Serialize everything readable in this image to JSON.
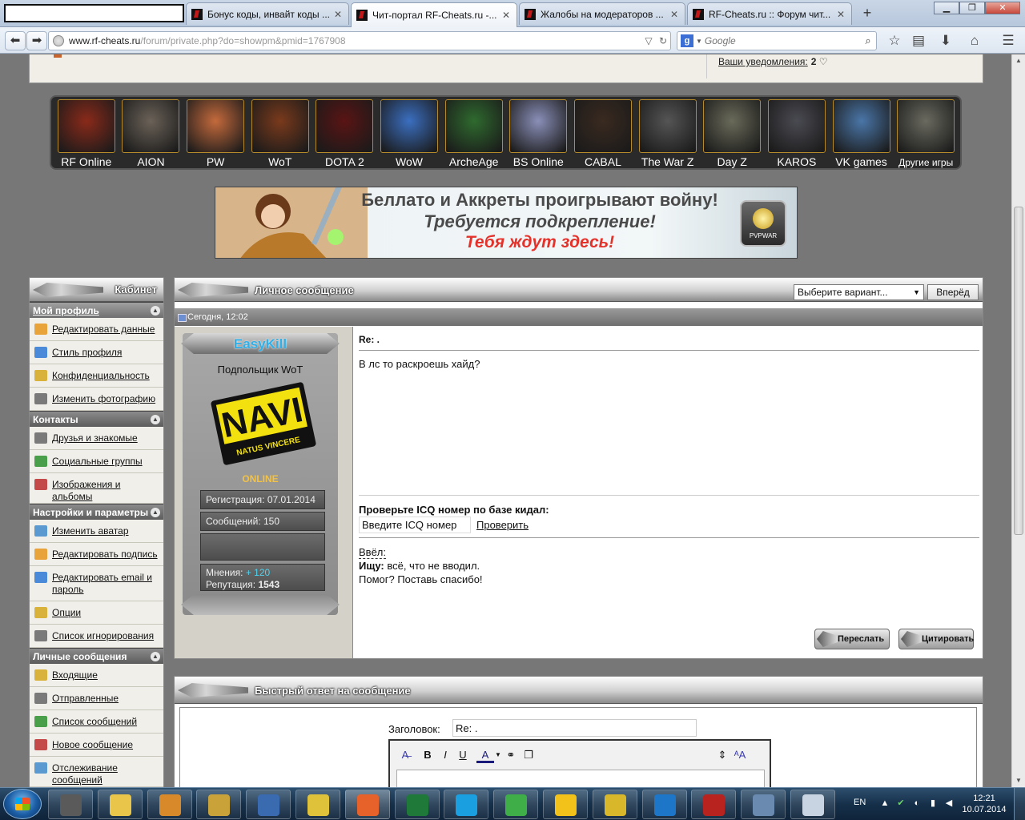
{
  "browser": {
    "tabs": [
      {
        "label": "Бонус коды, инвайт коды ..."
      },
      {
        "label": "Чит-портал RF-Cheats.ru -..."
      },
      {
        "label": "Жалобы на модераторов ..."
      },
      {
        "label": "RF-Cheats.ru :: Форум чит..."
      }
    ],
    "new_tab": "+",
    "url_domain": "www.rf-cheats.ru",
    "url_path": "/forum/private.php?do=showpm&pmid=1767908",
    "search_placeholder": "Google",
    "search_engine_letter": "g"
  },
  "page": {
    "notifications_label": "Ваши уведомления:",
    "notifications_count": "2",
    "games": [
      {
        "label": "RF Online",
        "color": "#8a2a1a"
      },
      {
        "label": "AION",
        "color": "#6b6258"
      },
      {
        "label": "PW",
        "color": "#c46a3c"
      },
      {
        "label": "WoT",
        "color": "#7a3a1c"
      },
      {
        "label": "DOTA 2",
        "color": "#5a1414"
      },
      {
        "label": "WoW",
        "color": "#3b6fc0"
      },
      {
        "label": "ArcheAge",
        "color": "#2f6a2f"
      },
      {
        "label": "BS Online",
        "color": "#8a8fb8"
      },
      {
        "label": "CABAL",
        "color": "#3a2a20"
      },
      {
        "label": "The War Z",
        "color": "#555555"
      },
      {
        "label": "Day Z",
        "color": "#6a6a5a"
      },
      {
        "label": "KAROS",
        "color": "#4a4a52"
      },
      {
        "label": "VK games",
        "color": "#4a76a8"
      },
      {
        "label": "Другие игры",
        "color": "#6a6a60"
      }
    ],
    "banner": {
      "line1": "Беллато и Аккреты проигрывают войну!",
      "line2": "Требуется подкрепление!",
      "line3": "Тебя ждут здесь!",
      "logo_text": "PVPWAR"
    },
    "sidebar": {
      "title": "Кабинет",
      "sections": [
        {
          "title": "Мой профиль",
          "items": [
            "Редактировать данные",
            "Стиль профиля",
            "Конфиденциальность",
            "Изменить фотографию"
          ]
        },
        {
          "title": "Контакты",
          "items": [
            "Друзья и знакомые",
            "Социальные группы",
            "Изображения и альбомы"
          ]
        },
        {
          "title": "Настройки и параметры",
          "items": [
            "Изменить аватар",
            "Редактировать подпись",
            "Редактировать email и пароль",
            "Опции",
            "Список игнорирования"
          ]
        },
        {
          "title": "Личные сообщения",
          "items": [
            "Входящие",
            "Отправленные",
            "Список сообщений",
            "Новое сообщение",
            "Отслеживание сообщений"
          ]
        }
      ]
    },
    "message": {
      "panel_title": "Личное сообщение",
      "select_value": "Выберите вариант...",
      "forward_label": "Вперёд",
      "date": "Сегодня, 12:02",
      "user": {
        "name": "EasyKill",
        "rank": "Подпольщик WoT",
        "avatar_text_top": "NAVI",
        "avatar_text_bottom": "NATUS VINCERE",
        "status": "ONLINE",
        "registration": "Регистрация: 07.01.2014",
        "posts": "Сообщений: 150",
        "opinions_label": "Мнения:",
        "opinions_value": "+ 120",
        "reputation_label": "Репутация:",
        "reputation_value": "1543"
      },
      "subject": "Re: .",
      "body": "В лс то раскроешь хайд?",
      "icq_title": "Проверьте ICQ номер по базе кидал:",
      "icq_placeholder": "Введите ICQ номер",
      "icq_button": "Проверить",
      "sig_line1": "Ввёл:",
      "sig_line2_bold": "Ищу:",
      "sig_line2_rest": "всё, что не вводил.",
      "sig_line3": "Помог? Поставь спасибо!",
      "forward_btn": "Переслать",
      "quote_btn": "Цитировать"
    },
    "quick_reply": {
      "title": "Быстрый ответ на сообщение",
      "subject_label": "Заголовок:",
      "subject_value": "Re: ."
    }
  },
  "taskbar": {
    "lang": "EN",
    "time": "12:21",
    "date": "10.07.2014",
    "apps": [
      {
        "name": "wot-icon",
        "color": "#5a5a5a"
      },
      {
        "name": "explorer-icon",
        "color": "#e9c64a"
      },
      {
        "name": "lightning-app-icon",
        "color": "#d88a2a"
      },
      {
        "name": "wow-icon",
        "color": "#c9a23a"
      },
      {
        "name": "wow-launcher-icon",
        "color": "#3a6ab0"
      },
      {
        "name": "chat-app-icon",
        "color": "#e0c23a"
      },
      {
        "name": "firefox-icon",
        "color": "#e6622a"
      },
      {
        "name": "excel-icon",
        "color": "#1f7a3a"
      },
      {
        "name": "skype-icon",
        "color": "#1aa0e0"
      },
      {
        "name": "chrome-icon",
        "color": "#3fae49"
      },
      {
        "name": "star-app-icon",
        "color": "#f2c21a"
      },
      {
        "name": "robot-app-icon",
        "color": "#d8b82a"
      },
      {
        "name": "teamviewer-icon",
        "color": "#1e76c8"
      },
      {
        "name": "filezilla-icon",
        "color": "#b8231f"
      },
      {
        "name": "image-viewer-icon",
        "color": "#6a8ab0"
      },
      {
        "name": "calculator-icon",
        "color": "#c8d4e2"
      }
    ]
  }
}
